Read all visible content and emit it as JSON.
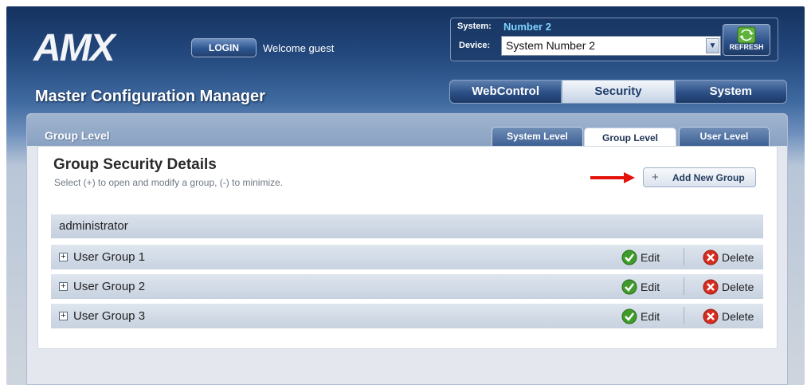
{
  "header": {
    "logo_text": "AMX",
    "login_label": "LOGIN",
    "welcome_text": "Welcome guest",
    "app_title": "Master Configuration Manager"
  },
  "system_selector": {
    "system_label": "System:",
    "system_value": "Number 2",
    "device_label": "Device:",
    "device_value": "System Number 2",
    "refresh_label": "REFRESH"
  },
  "main_tabs": [
    {
      "label": "WebControl",
      "active": false
    },
    {
      "label": "Security",
      "active": true
    },
    {
      "label": "System",
      "active": false
    }
  ],
  "panel": {
    "title": "Group Level",
    "sub_tabs": [
      {
        "label": "System Level",
        "active": false
      },
      {
        "label": "Group Level",
        "active": true
      },
      {
        "label": "User Level",
        "active": false
      }
    ],
    "details_title": "Group Security Details",
    "details_subtitle": "Select (+) to open and modify a group, (-) to minimize.",
    "add_button_label": "Add New Group",
    "admin_group": "administrator",
    "groups": [
      {
        "name": "User Group 1"
      },
      {
        "name": "User Group 2"
      },
      {
        "name": "User Group 3"
      }
    ],
    "edit_label": "Edit",
    "delete_label": "Delete"
  },
  "colors": {
    "header_dark": "#15325f",
    "accent_cyan": "#7fd2ff",
    "annotation_arrow": "#e3120b",
    "edit_green": "#3f9b2a",
    "delete_red": "#d62d20"
  }
}
